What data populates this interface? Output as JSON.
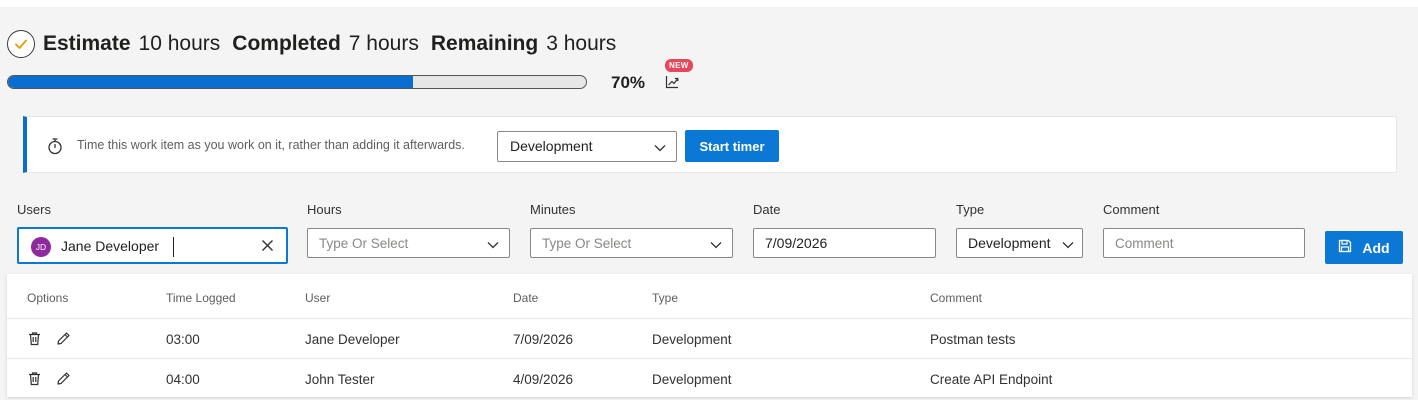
{
  "summary": {
    "estimate_label": "Estimate",
    "estimate_value": "10 hours",
    "completed_label": "Completed",
    "completed_value": "7 hours",
    "remaining_label": "Remaining",
    "remaining_value": "3 hours"
  },
  "progress": {
    "percent_text": "70%",
    "percent_value": 70,
    "new_badge": "NEW"
  },
  "timer": {
    "description": "Time this work item as you work on it, rather than adding it afterwards.",
    "type_selected": "Development",
    "start_label": "Start timer"
  },
  "form": {
    "users_label": "Users",
    "hours_label": "Hours",
    "minutes_label": "Minutes",
    "date_label": "Date",
    "type_label": "Type",
    "comment_label": "Comment",
    "user_initials": "JD",
    "user_value": "Jane Developer",
    "hours_placeholder": "Type Or Select",
    "minutes_placeholder": "Type Or Select",
    "date_value": "7/09/2026",
    "type_value": "Development",
    "comment_placeholder": "Comment",
    "add_label": "Add"
  },
  "table": {
    "headers": {
      "options": "Options",
      "time_logged": "Time Logged",
      "user": "User",
      "date": "Date",
      "type": "Type",
      "comment": "Comment"
    },
    "rows": [
      {
        "time": "03:00",
        "user": "Jane Developer",
        "date": "7/09/2026",
        "type": "Development",
        "comment": "Postman tests"
      },
      {
        "time": "04:00",
        "user": "John Tester",
        "date": "4/09/2026",
        "type": "Development",
        "comment": "Create API Endpoint"
      }
    ]
  },
  "colors": {
    "accent": "#0a78d4",
    "progress_fill": "#0a6ed1",
    "badge": "#e8475b",
    "avatar": "#8e2a9e"
  }
}
